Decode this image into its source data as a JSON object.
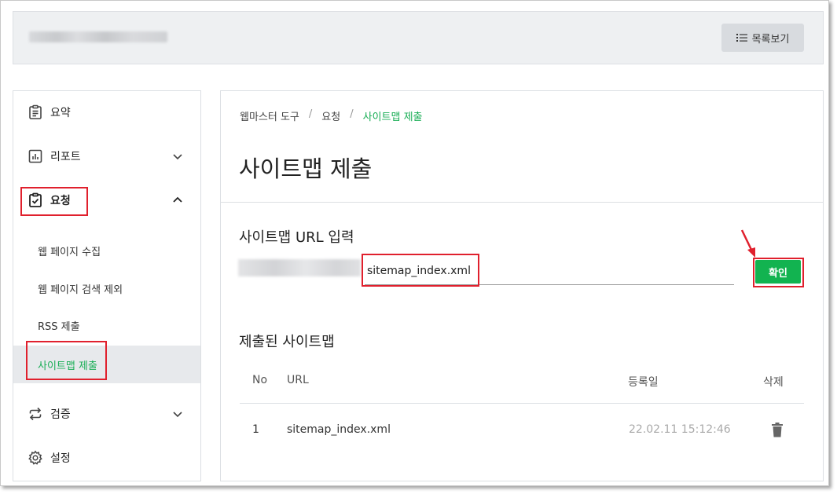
{
  "header": {
    "list_button_label": "목록보기"
  },
  "sidebar": {
    "items": [
      {
        "label": "요약",
        "icon": "clipboard-list-icon"
      },
      {
        "label": "리포트",
        "icon": "bar-chart-icon"
      },
      {
        "label": "요청",
        "icon": "clipboard-check-icon"
      },
      {
        "label": "검증",
        "icon": "repeat-icon"
      },
      {
        "label": "설정",
        "icon": "gear-icon"
      }
    ],
    "subitems": [
      {
        "label": "웹 페이지 수집"
      },
      {
        "label": "웹 페이지 검색 제외"
      },
      {
        "label": "RSS 제출"
      },
      {
        "label": "사이트맵 제출"
      }
    ]
  },
  "breadcrumb": {
    "items": [
      "웹마스터 도구",
      "요청",
      "사이트맵 제출"
    ],
    "separator": "/"
  },
  "page_title": "사이트맵 제출",
  "form": {
    "section_label": "사이트맵 URL 입력",
    "url_value": "sitemap_index.xml",
    "submit_label": "확인"
  },
  "submitted": {
    "section_label": "제출된 사이트맵",
    "columns": {
      "no": "No",
      "url": "URL",
      "date": "등록일",
      "delete": "삭제"
    },
    "rows": [
      {
        "no": "1",
        "url": "sitemap_index.xml",
        "date": "22.02.11 15:12:46"
      }
    ]
  },
  "colors": {
    "accent_green": "#1aae56",
    "highlight_red": "#e0202d"
  }
}
